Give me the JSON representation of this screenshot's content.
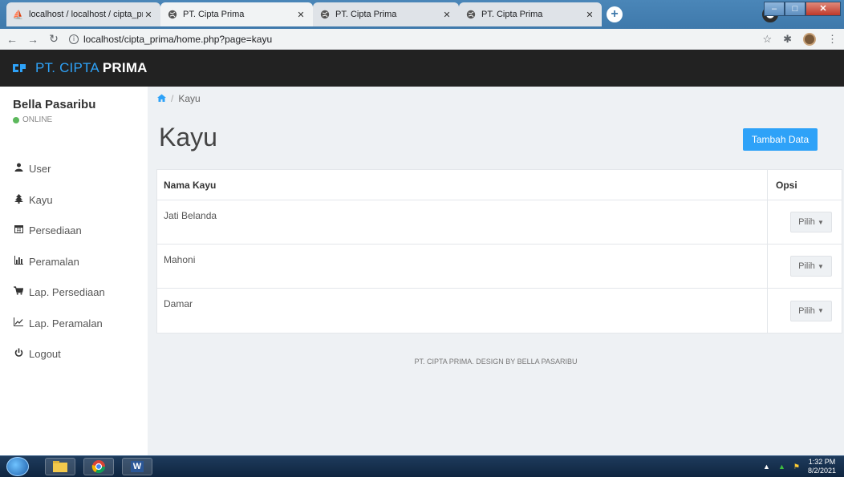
{
  "browser": {
    "tabs": [
      {
        "title": "localhost / localhost / cipta_prim",
        "icon": "phpmyadmin-icon",
        "active": false
      },
      {
        "title": "PT. Cipta Prima",
        "icon": "globe-icon",
        "active": true
      },
      {
        "title": "PT. Cipta Prima",
        "icon": "globe-icon",
        "active": false
      },
      {
        "title": "PT. Cipta Prima",
        "icon": "globe-icon",
        "active": false
      }
    ],
    "url": "localhost/cipta_prima/home.php?page=kayu"
  },
  "navbar": {
    "brand_light": "PT. CIPTA ",
    "brand_bold": "PRIMA"
  },
  "sidebar": {
    "user_name": "Bella Pasaribu",
    "status": "ONLINE",
    "items": [
      {
        "label": "User",
        "icon": "user-icon"
      },
      {
        "label": "Kayu",
        "icon": "tree-icon"
      },
      {
        "label": "Persediaan",
        "icon": "calendar-icon"
      },
      {
        "label": "Peramalan",
        "icon": "bar-chart-icon"
      },
      {
        "label": "Lap. Persediaan",
        "icon": "cart-icon"
      },
      {
        "label": "Lap. Peramalan",
        "icon": "line-chart-icon"
      },
      {
        "label": "Logout",
        "icon": "power-icon"
      }
    ]
  },
  "main": {
    "breadcrumb": "Kayu",
    "title": "Kayu",
    "add_button": "Tambah Data",
    "table": {
      "headers": [
        "Nama Kayu",
        "Opsi"
      ],
      "rows": [
        {
          "name": "Jati Belanda",
          "action": "Pilih"
        },
        {
          "name": "Mahoni",
          "action": "Pilih"
        },
        {
          "name": "Damar",
          "action": "Pilih"
        }
      ]
    },
    "footer": "PT. CIPTA PRIMA. DESIGN BY BELLA PASARIBU"
  },
  "taskbar": {
    "time": "1:32 PM",
    "date": "8/2/2021"
  },
  "colors": {
    "accent": "#2ea2f8",
    "navbar": "#222222",
    "content_bg": "#eef1f4",
    "online": "#5cb85c"
  }
}
